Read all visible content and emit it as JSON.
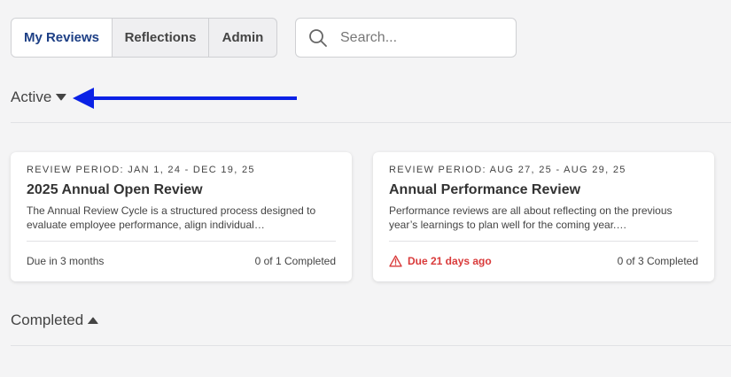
{
  "tabs": [
    {
      "label": "My Reviews",
      "active": true
    },
    {
      "label": "Reflections",
      "active": false
    },
    {
      "label": "Admin",
      "active": false
    }
  ],
  "search": {
    "placeholder": "Search...",
    "value": ""
  },
  "sections": {
    "active": {
      "label": "Active",
      "caret": "caret-down-icon"
    },
    "completed": {
      "label": "Completed",
      "caret": "caret-up-icon"
    }
  },
  "cards": [
    {
      "period": "REVIEW PERIOD: JAN 1, 24 - DEC 19, 25",
      "title": "2025 Annual Open Review",
      "description": "The Annual Review Cycle is a structured process designed to evaluate employee performance, align individual…",
      "due": "Due in 3 months",
      "overdue": false,
      "progress": "0 of 1 Completed"
    },
    {
      "period": "REVIEW PERIOD: AUG 27, 25 - AUG 29, 25",
      "title": "Annual Performance Review",
      "description": "Performance reviews are all about reflecting on the previous year’s learnings to plan well for the coming year.…",
      "due": "Due 21 days ago",
      "overdue": true,
      "progress": "0 of 3 Completed"
    }
  ],
  "colors": {
    "accent": "#1d3f85",
    "overdue": "#d93a3a",
    "annotation_arrow": "#0a21e6"
  }
}
